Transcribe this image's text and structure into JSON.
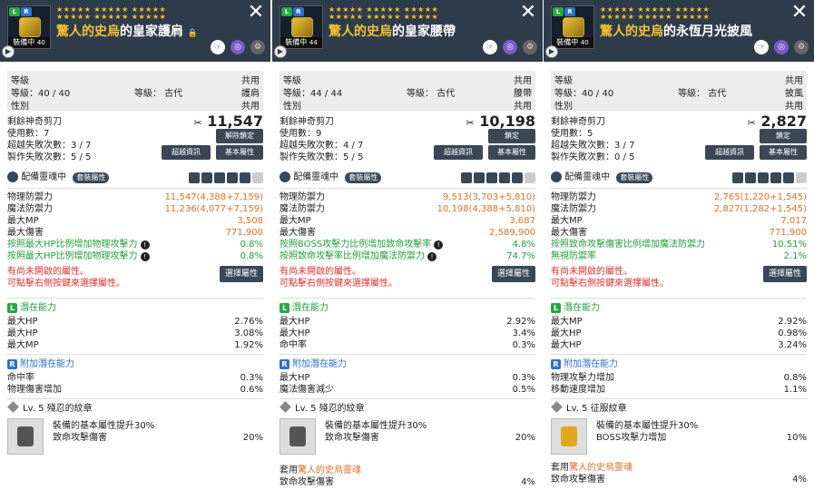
{
  "panels": [
    {
      "prefix": "驚人的史烏",
      "name": "的皇家護肩",
      "lock": "🔒",
      "stars_row1": "★★★★★ ★★★★★ ★★★★★",
      "stars_row2": "★★★★★ ★★★★★ ★★★★★",
      "equipped": "裝備中",
      "level": "40",
      "grey": {
        "l1": "等級",
        "l2": "等級：40 / 40",
        "l3": "等級： 古代",
        "l4": "性別",
        "r1": "共用",
        "r2": "護肩",
        "r3": "共用"
      },
      "scissor_label": "剩餘神奇剪刀",
      "scissor_count": "11,547",
      "uses": "使用數：7",
      "fail": "超越失敗次數：3 / 7",
      "craft": "製作失敗次數：5 / 5",
      "btn_a": "解除鎖定",
      "btn_b": "超越資訊",
      "btn_c": "基本屬性",
      "soul": "配備靈魂中",
      "set_tag": "套裝屬性",
      "stats": [
        {
          "label": "物理防禦力",
          "value": "11,547(4,388+7,159)",
          "cls": "orange"
        },
        {
          "label": "魔法防禦力",
          "value": "11,236(4,077+7,159)",
          "cls": "orange"
        },
        {
          "label": "最大MP",
          "value": "3,508",
          "cls": "orange"
        },
        {
          "label": "最大傷害",
          "value": "771,900",
          "cls": "orange"
        },
        {
          "label": "按照最大HP比例增加物理攻擊力",
          "value": "0.8%",
          "cls": "green",
          "info": true
        },
        {
          "label": "按照最大HP比例增加物理攻擊力",
          "value": "0.8%",
          "cls": "green",
          "info": true
        }
      ],
      "unopened": "有尚未開啟的屬性。",
      "unopened2": "可點擊右側按鍵來選擇屬性。",
      "select_btn": "選擇屬性",
      "pot_title": "潛在能力",
      "pot": [
        {
          "label": "最大HP",
          "value": "2.76%"
        },
        {
          "label": "最大HP",
          "value": "3.08%"
        },
        {
          "label": "最大MP",
          "value": "1.92%"
        }
      ],
      "add_title": "附加潛在能力",
      "add": [
        {
          "label": "命中率",
          "value": "0.3%"
        },
        {
          "label": "物理傷害增加",
          "value": "0.6%"
        }
      ],
      "emblem": "Lv. 5 殘忍的紋章",
      "emb_line1": "裝備的基本屬性提升30%",
      "emb_label": "致命攻擊傷害",
      "emb_value": "20%"
    },
    {
      "prefix": "驚人的史烏",
      "name": "的皇家腰帶",
      "stars_row1": "★★★★★ ★★★★★ ★★★★★",
      "stars_row2": "★★★★★ ★★★★★ ★★★★★",
      "equipped": "裝備中",
      "level": "44",
      "grey": {
        "l1": "等級",
        "l2": "等級：44 / 44",
        "l3": "等級： 古代",
        "l4": "性別",
        "r1": "共用",
        "r2": "腰帶",
        "r3": "共用"
      },
      "scissor_label": "剩餘神奇剪刀",
      "scissor_count": "10,198",
      "uses": "使用數：9",
      "fail": "超越失敗次數：4 / 7",
      "craft": "製作失敗次數：5 / 5",
      "btn_a": "鎖定",
      "btn_b": "超越資訊",
      "btn_c": "基本屬性",
      "soul": "配備靈魂中",
      "set_tag": "套裝屬性",
      "stats": [
        {
          "label": "物理防禦力",
          "value": "9,513(3,703+5,810)",
          "cls": "orange"
        },
        {
          "label": "魔法防禦力",
          "value": "10,198(4,388+5,810)",
          "cls": "orange"
        },
        {
          "label": "最大MP",
          "value": "3,687",
          "cls": "orange"
        },
        {
          "label": "最大傷害",
          "value": "2,589,900",
          "cls": "orange"
        },
        {
          "label": "按照BOSS攻擊力比例增加致命攻擊率",
          "value": "4.8%",
          "cls": "green",
          "info": true
        },
        {
          "label": "按照致命攻擊率比例增加魔法防禦力",
          "value": "74.7%",
          "cls": "green",
          "info": true
        }
      ],
      "unopened": "有尚未開啟的屬性。",
      "unopened2": "可點擊右側按鍵來選擇屬性。",
      "select_btn": "選擇屬性",
      "pot_title": "潛在能力",
      "pot": [
        {
          "label": "最大HP",
          "value": "2.92%"
        },
        {
          "label": "最大HP",
          "value": "3.4%"
        },
        {
          "label": "命中率",
          "value": "0.3%"
        }
      ],
      "add_title": "附加潛在能力",
      "add": [
        {
          "label": "最大HP",
          "value": "0.3%"
        },
        {
          "label": "魔法傷害減少",
          "value": "0.5%"
        }
      ],
      "emblem": "Lv. 5 殘忍的紋章",
      "emb_line1": "裝備的基本屬性提升30%",
      "emb_label": "致命攻擊傷害",
      "emb_value": "20%",
      "set_prefix": "套用",
      "set_name": "驚人的史烏靈魂",
      "set_label": "致命攻擊傷害",
      "set_value": "4%"
    },
    {
      "prefix": "驚人的史烏",
      "name": "的永恆月光披風",
      "stars_row1": "★★★★★ ★★★★★ ★★★★★",
      "stars_row2": "★★★★★ ★★★★★ ★★★★★",
      "equipped": "裝備中",
      "level": "40",
      "grey": {
        "l1": "等級",
        "l2": "等級：40 / 40",
        "l3": "等級： 古代",
        "l4": "性別",
        "r1": "共用",
        "r2": "披風",
        "r3": "共用"
      },
      "scissor_label": "剩餘神奇剪刀",
      "scissor_count": "2,827",
      "uses": "使用數：5",
      "fail": "超越失敗次數：3 / 7",
      "craft": "製作失敗次數：0 / 5",
      "btn_a": "鎖定",
      "btn_b": "超越資訊",
      "btn_c": "基本屬性",
      "soul": "配備靈魂中",
      "set_tag": "套裝屬性",
      "stats": [
        {
          "label": "物理防禦力",
          "value": "2,765(1,220+1,545)",
          "cls": "orange"
        },
        {
          "label": "魔法防禦力",
          "value": "2,827(1,282+1,545)",
          "cls": "orange"
        },
        {
          "label": "最大MP",
          "value": "7,017",
          "cls": "orange"
        },
        {
          "label": "最大傷害",
          "value": "771,900",
          "cls": "orange"
        },
        {
          "label": "按照致命攻擊傷害比例增加魔法防禦力",
          "value": "10.51%",
          "cls": "green"
        },
        {
          "label": "無視防禦率",
          "value": "2.1%",
          "cls": "green"
        }
      ],
      "unopened": "有尚未開啟的屬性。",
      "unopened2": "可點擊右側按鍵來選擇屬性。",
      "select_btn": "選擇屬性",
      "pot_title": "潛在能力",
      "pot": [
        {
          "label": "最大MP",
          "value": "2.92%"
        },
        {
          "label": "最大HP",
          "value": "0.98%"
        },
        {
          "label": "最大HP",
          "value": "3.24%"
        }
      ],
      "add_title": "附加潛在能力",
      "add": [
        {
          "label": "物理攻擊力增加",
          "value": "0.8%"
        },
        {
          "label": "移動速度增加",
          "value": "1.1%"
        }
      ],
      "emblem": "Lv. 5 征服紋章",
      "emb_line1": "裝備的基本屬性提升30%",
      "emb_label": "BOSS攻擊力增加",
      "emb_value": "10%",
      "set_prefix": "套用",
      "set_name": "驚人的史烏靈魂",
      "set_label": "致命攻擊傷害",
      "set_value": "4%"
    }
  ]
}
